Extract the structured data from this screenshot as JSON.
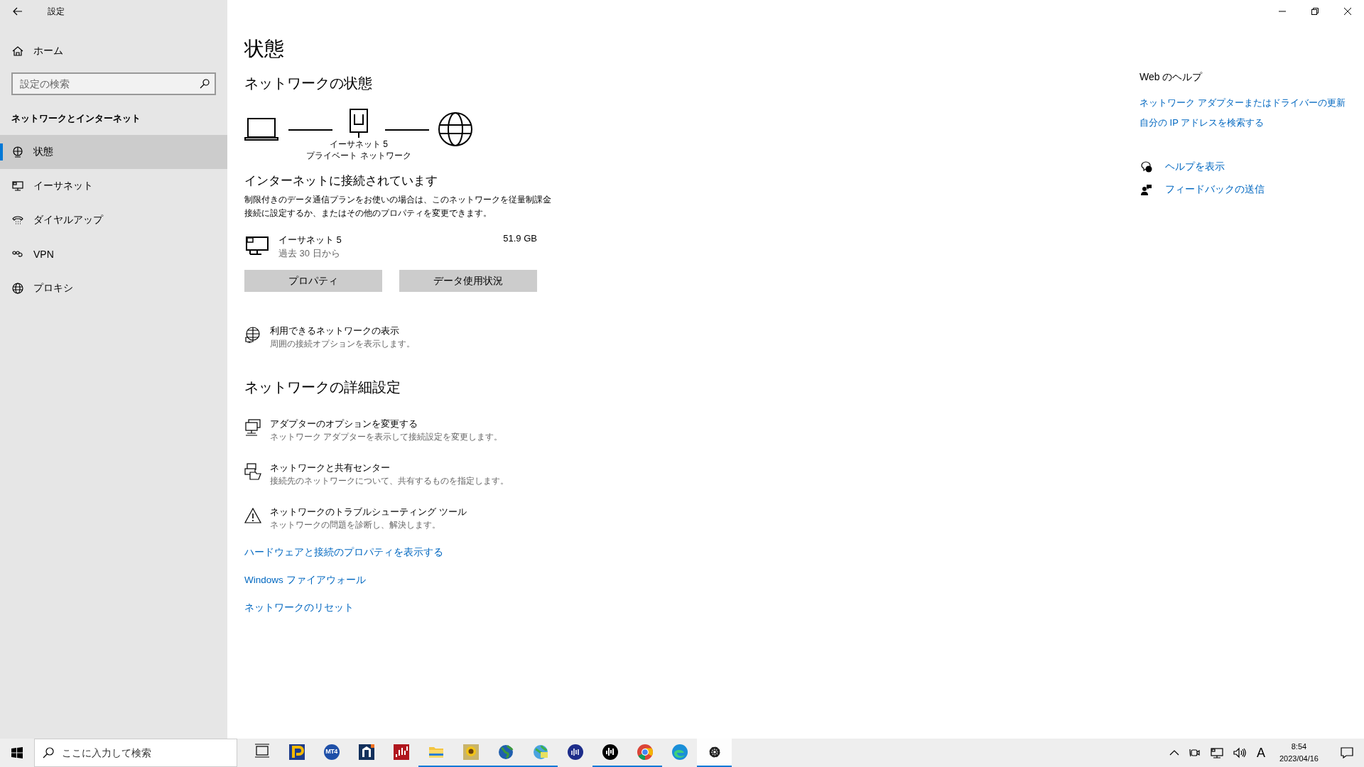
{
  "window": {
    "title": "設定"
  },
  "sidebar": {
    "home": "ホーム",
    "search": {
      "placeholder": "設定の検索"
    },
    "category": "ネットワークとインターネット",
    "items": [
      {
        "kind": "status",
        "label": "状態",
        "selected": true
      },
      {
        "kind": "ethernet",
        "label": "イーサネット",
        "selected": false
      },
      {
        "kind": "dialup",
        "label": "ダイヤルアップ",
        "selected": false
      },
      {
        "kind": "vpn",
        "label": "VPN",
        "selected": false
      },
      {
        "kind": "proxy",
        "label": "プロキシ",
        "selected": false
      }
    ]
  },
  "page": {
    "title": "状態",
    "section": "ネットワークの状態",
    "diagram": {
      "adapter": "イーサネット 5",
      "network": "プライベート ネットワーク"
    },
    "connection_heading": "インターネットに接続されています",
    "connection_text": "制限付きのデータ通信プランをお使いの場合は、このネットワークを従量制課金接続に設定するか、またはその他のプロパティを変更できます。",
    "usage": {
      "name": "イーサネット 5",
      "period": "過去 30 日から",
      "amount": "51.9 GB"
    },
    "buttons": [
      "プロパティ",
      "データ使用状況"
    ],
    "available": {
      "title": "利用できるネットワークの表示",
      "description": "周囲の接続オプションを表示します。"
    },
    "advanced_heading": "ネットワークの詳細設定",
    "advanced": [
      {
        "kind": "adapter",
        "title": "アダプターのオプションを変更する",
        "description": "ネットワーク アダプターを表示して接続設定を変更します。"
      },
      {
        "kind": "sharing",
        "title": "ネットワークと共有センター",
        "description": "接続先のネットワークについて、共有するものを指定します。"
      },
      {
        "kind": "troubleshoot",
        "title": "ネットワークのトラブルシューティング ツール",
        "description": "ネットワークの問題を診断し、解決します。"
      }
    ],
    "links": [
      "ハードウェアと接続のプロパティを表示する",
      "Windows ファイアウォール",
      "ネットワークのリセット"
    ]
  },
  "help": {
    "heading": "Web のヘルプ",
    "links": [
      "ネットワーク アダプターまたはドライバーの更新",
      "自分の IP アドレスを検索する"
    ],
    "actions": [
      {
        "kind": "help",
        "label": "ヘルプを表示"
      },
      {
        "kind": "feedback",
        "label": "フィードバックの送信"
      }
    ]
  },
  "taskbar": {
    "search": {
      "placeholder": "ここに入力して検索"
    },
    "apps": [
      {
        "kind": "taskview",
        "running": false,
        "selected": false
      },
      {
        "kind": "p",
        "running": false,
        "selected": false
      },
      {
        "kind": "mt4",
        "label": "MT4",
        "running": false,
        "selected": false
      },
      {
        "kind": "n",
        "running": false,
        "selected": false
      },
      {
        "kind": "chart",
        "running": false,
        "selected": false
      },
      {
        "kind": "folder",
        "running": true,
        "selected": false
      },
      {
        "kind": "flower",
        "running": true,
        "selected": false
      },
      {
        "kind": "globe",
        "running": true,
        "selected": false
      },
      {
        "kind": "globe2",
        "running": true,
        "selected": false
      },
      {
        "kind": "bluewave",
        "running": false,
        "selected": false
      },
      {
        "kind": "blackwave",
        "running": true,
        "selected": false
      },
      {
        "kind": "chrome",
        "running": true,
        "selected": false
      },
      {
        "kind": "edge",
        "running": false,
        "selected": false
      },
      {
        "kind": "gear",
        "running": true,
        "selected": true
      }
    ],
    "ime": "A",
    "time": "8:54",
    "date": "2023/04/16"
  }
}
